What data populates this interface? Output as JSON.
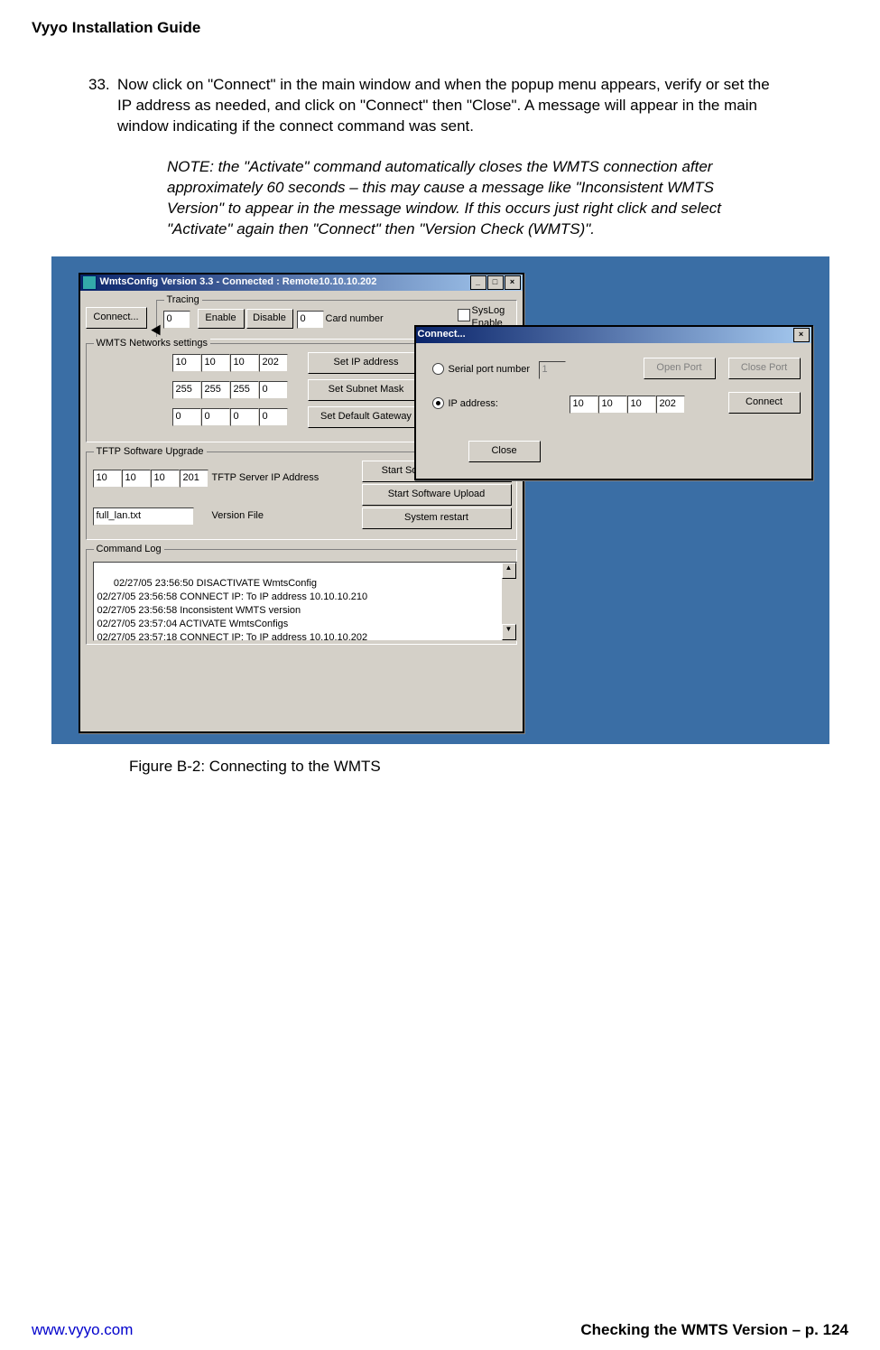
{
  "doc": {
    "title": "Vyyo Installation Guide",
    "step_number": "33.",
    "step_text": "Now click on \"Connect\" in the main window and when the popup menu appears, verify or set the IP address as needed,  and click on \"Connect\" then \"Close\".  A message will appear in the main window indicating if the connect command was sent.",
    "note_text": "NOTE: the \"Activate\" command automatically closes the WMTS connection after approximately 60 seconds – this may cause a message like \"Inconsistent WMTS Version\" to appear in the message window.  If this occurs just right click and select \"Activate\" again then \"Connect\" then \"Version Check (WMTS)\".",
    "figure_caption": "Figure B-2:  Connecting to the WMTS",
    "footer_left": "www.vyyo.com",
    "footer_right": "Checking the WMTS Version – p. 124"
  },
  "main_window": {
    "title": "WmtsConfig Version 3.3 - Connected : Remote10.10.10.202",
    "titlebar_buttons": {
      "min": "_",
      "max": "□",
      "close": "×"
    },
    "connect_button": "Connect...",
    "tracing": {
      "group_label": "Tracing",
      "value": "0",
      "enable": "Enable",
      "disable": "Disable",
      "card_value": "0",
      "card_label": "Card number",
      "syslog_label": "SysLog\nEnable"
    },
    "networks": {
      "group_label": "WMTS Networks settings",
      "ip": [
        "10",
        "10",
        "10",
        "202"
      ],
      "subnet": [
        "255",
        "255",
        "255",
        "0"
      ],
      "gateway": [
        "0",
        "0",
        "0",
        "0"
      ],
      "set_ip": "Set IP address",
      "set_subnet": "Set Subnet Mask",
      "set_gateway": "Set Default Gateway"
    },
    "tftp": {
      "group_label": "TFTP Software Upgrade",
      "ip": [
        "10",
        "10",
        "10",
        "201"
      ],
      "ip_label": "TFTP Server IP Address",
      "version_file": "full_lan.txt",
      "version_label": "Version File",
      "start_download": "Start Software Download",
      "start_upload": "Start Software Upload",
      "system_restart": "System restart"
    },
    "log": {
      "group_label": "Command Log",
      "lines": "02/27/05 23:56:50 DISACTIVATE WmtsConfig\n02/27/05 23:56:58 CONNECT IP: To IP address 10.10.10.210\n02/27/05 23:56:58 Inconsistent WMTS version\n02/27/05 23:57:04 ACTIVATE WmtsConfigs\n02/27/05 23:57:18 CONNECT IP: To IP address 10.10.10.202"
    }
  },
  "connect_dialog": {
    "title": "Connect...",
    "close_x": "×",
    "serial_label": "Serial port number",
    "serial_value": "1",
    "ip_label": "IP address:",
    "ip": [
      "10",
      "10",
      "10",
      "202"
    ],
    "open_port": "Open Port",
    "close_port": "Close Port",
    "connect": "Connect",
    "close": "Close"
  }
}
